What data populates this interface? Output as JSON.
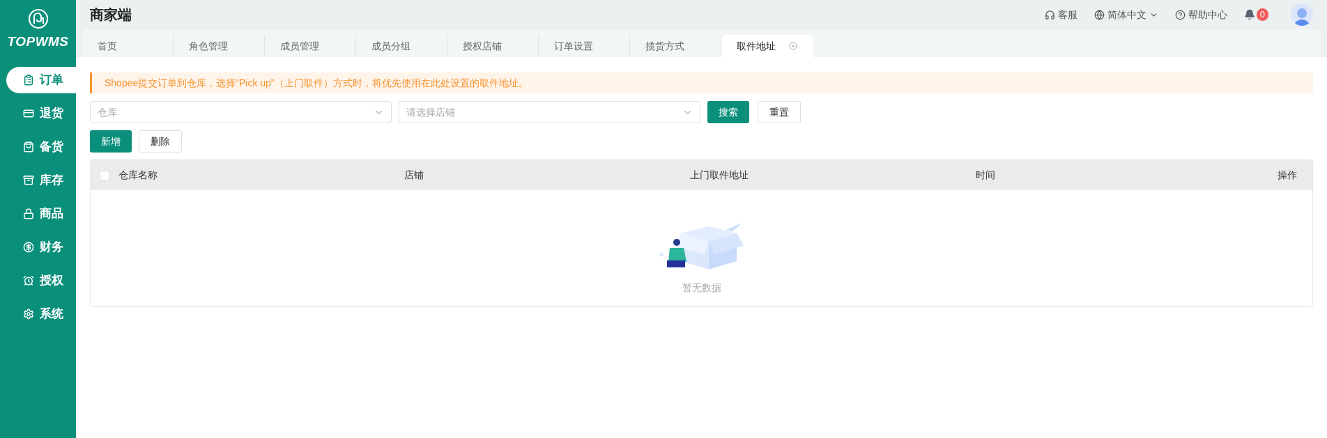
{
  "brand": {
    "name": "TOPWMS"
  },
  "sidebar": {
    "items": [
      {
        "label": "订单",
        "selected": true
      },
      {
        "label": "退货",
        "selected": false
      },
      {
        "label": "备货",
        "selected": false
      },
      {
        "label": "库存",
        "selected": false
      },
      {
        "label": "商品",
        "selected": false
      },
      {
        "label": "财务",
        "selected": false
      },
      {
        "label": "授权",
        "selected": false
      },
      {
        "label": "系统",
        "selected": false
      }
    ]
  },
  "header": {
    "title": "商家端",
    "service": "客服",
    "language": "简体中文",
    "help": "帮助中心",
    "notifications": "0"
  },
  "tabs": [
    {
      "label": "首页",
      "selected": false
    },
    {
      "label": "角色管理",
      "selected": false
    },
    {
      "label": "成员管理",
      "selected": false
    },
    {
      "label": "成员分组",
      "selected": false
    },
    {
      "label": "授权店铺",
      "selected": false
    },
    {
      "label": "订单设置",
      "selected": false
    },
    {
      "label": "揽货方式",
      "selected": false
    },
    {
      "label": "取件地址",
      "selected": true
    }
  ],
  "alert": "Shopee提交订单到仓库，选择“Pick up”（上门取件）方式时，将优先使用在此处设置的取件地址。",
  "filters": {
    "warehouse": {
      "placeholder": "仓库"
    },
    "shop": {
      "placeholder": "请选择店铺"
    },
    "search": "搜索",
    "reset": "重置"
  },
  "actions": {
    "add": "新增",
    "delete": "删除"
  },
  "table": {
    "select_all": {
      "checked": false
    },
    "columns": [
      "仓库名称",
      "店铺",
      "上门取件地址",
      "时间",
      "操作"
    ],
    "empty": "暂无数据"
  }
}
